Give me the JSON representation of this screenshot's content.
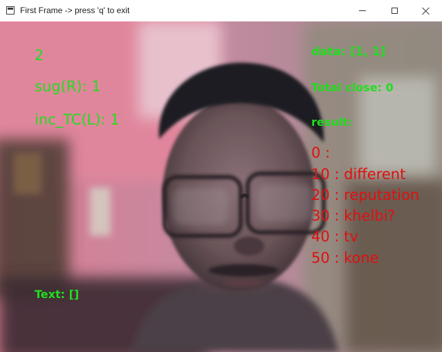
{
  "window": {
    "title": "First Frame -> press 'q' to exit",
    "app_icon": "window-app-icon",
    "controls": {
      "minimize_icon": "minimize-icon",
      "maximize_icon": "maximize-icon",
      "close_icon": "close-icon"
    }
  },
  "overlay": {
    "count": "2",
    "sug": "sug(R): 1",
    "inc_tc": "inc_TC(L): 1",
    "text_label": "Text: []",
    "data": "data: [1, 1]",
    "total_close": "Total close: 0",
    "result_label": "result:",
    "results": [
      "0 :",
      "10 : different",
      "20 : reputation",
      "30 : khelbi?",
      "40 : tv",
      "50 : kone"
    ]
  },
  "colors": {
    "overlay_green": "#22dd1e",
    "overlay_red": "#e01010",
    "titlebar_bg": "#ffffff"
  }
}
